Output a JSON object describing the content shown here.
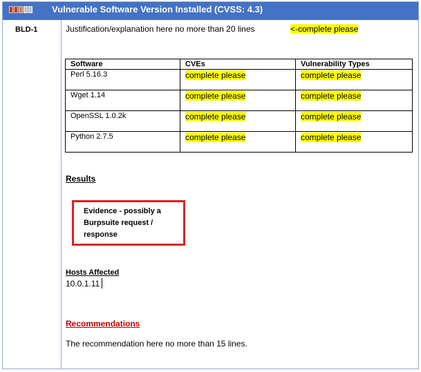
{
  "header": {
    "severity_icon": "severity-bars-icon",
    "title": "Vulnerable Software Version Installed (CVSS: 4.3)"
  },
  "finding": {
    "id": "BLD-1",
    "justification": "Justification/explanation here no more than 20 lines",
    "justification_note": "<-complete please"
  },
  "table": {
    "headers": [
      "Software",
      "CVEs",
      "Vulnerability Types"
    ],
    "rows": [
      [
        "Perl 5.16.3",
        "complete please",
        "complete please"
      ],
      [
        "Wget 1.14",
        "complete please",
        "complete please"
      ],
      [
        "OpenSSL 1.0.2k",
        "complete please",
        "complete please"
      ],
      [
        "Python 2.7.5",
        "complete please",
        "complete please"
      ]
    ]
  },
  "results": {
    "heading": "Results",
    "evidence_lines": [
      "Evidence - possibly a",
      "Burpsuite request /",
      "response"
    ]
  },
  "hosts": {
    "heading": "Hosts Affected",
    "value": "10.0.1.11"
  },
  "recommendations": {
    "heading": "Recommendations",
    "text": "The recommendation here no more than 15 lines."
  },
  "colors": {
    "header_bg": "#4472c4",
    "border": "#8eaadb",
    "highlight": "#ffff00",
    "evidence_border": "#e02020",
    "recommendations_heading": "#c00000"
  }
}
